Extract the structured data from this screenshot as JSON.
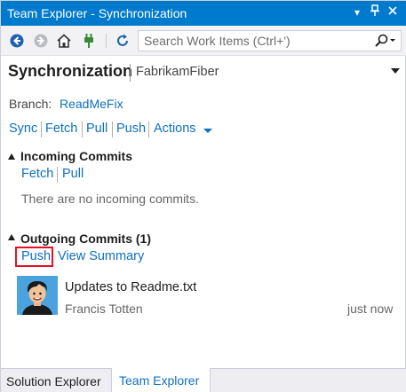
{
  "window": {
    "title": "Team Explorer - Synchronization"
  },
  "toolbar": {
    "search_placeholder": "Search Work Items (Ctrl+')",
    "icons": [
      "back-icon",
      "forward-icon",
      "home-icon",
      "connect-icon",
      "refresh-icon",
      "search-icon"
    ]
  },
  "header": {
    "title": "Synchronization",
    "repo": "FabrikamFiber"
  },
  "branch": {
    "label": "Branch:",
    "name": "ReadMeFix"
  },
  "actions_bar": {
    "sync": "Sync",
    "fetch": "Fetch",
    "pull": "Pull",
    "push": "Push",
    "actions": "Actions"
  },
  "incoming": {
    "title": "Incoming Commits",
    "fetch": "Fetch",
    "pull": "Pull",
    "empty": "There are no incoming commits."
  },
  "outgoing": {
    "title": "Outgoing Commits (1)",
    "push": "Push",
    "view_summary": "View Summary",
    "commits": [
      {
        "message": "Updates to Readme.txt",
        "author": "Francis Totten",
        "time": "just now"
      }
    ]
  },
  "tabs": [
    {
      "label": "Solution Explorer",
      "active": false
    },
    {
      "label": "Team Explorer",
      "active": true
    }
  ],
  "colors": {
    "accent": "#007acc",
    "link": "#0e70c0",
    "highlight_box": "#e81123"
  }
}
